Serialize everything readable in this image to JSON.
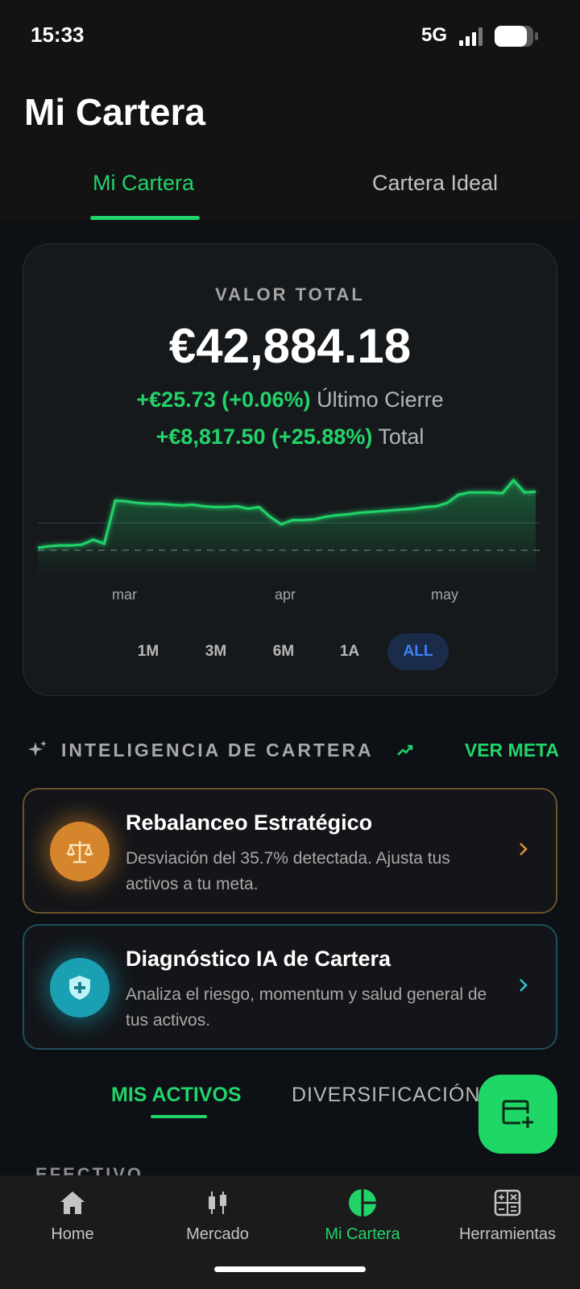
{
  "status_bar": {
    "time": "15:33",
    "network": "5G"
  },
  "header": {
    "title": "Mi Cartera"
  },
  "tabs": [
    {
      "label": "Mi Cartera",
      "active": true
    },
    {
      "label": "Cartera Ideal",
      "active": false
    }
  ],
  "portfolio": {
    "label": "VALOR TOTAL",
    "value": "€42,884.18",
    "last_close_change": "+€25.73 (+0.06%)",
    "last_close_label": "Último Cierre",
    "total_change": "+€8,817.50 (+25.88%)",
    "total_label": "Total"
  },
  "chart_data": {
    "type": "line",
    "x_labels": [
      "mar",
      "apr",
      "may"
    ],
    "series": [
      {
        "values": [
          33200,
          33400,
          33500,
          33500,
          33600,
          34200,
          33700,
          39000,
          38900,
          38700,
          38600,
          38600,
          38500,
          38400,
          38500,
          38300,
          38200,
          38200,
          38300,
          38000,
          38200,
          37000,
          36100,
          36600,
          36600,
          36700,
          37000,
          37200,
          37300,
          37500,
          37600,
          37700,
          37800,
          37900,
          38000,
          38200,
          38300,
          38700,
          39700,
          40000,
          40000,
          40000,
          39900,
          41500,
          40000,
          40100
        ]
      }
    ],
    "color": "#22d36a",
    "range_options": [
      "1M",
      "3M",
      "6M",
      "1A",
      "ALL"
    ],
    "selected_range": "ALL"
  },
  "intelligence": {
    "title": "INTELIGENCIA DE CARTERA",
    "action_label": "VER META",
    "cards": [
      {
        "title": "Rebalanceo Estratégico",
        "description": "Desviación del 35.7% detectada. Ajusta tus activos a tu meta.",
        "icon": "balance-scale-icon",
        "accent": "#d5852c"
      },
      {
        "title": "Diagnóstico IA de Cartera",
        "description": "Analiza el riesgo, momentum y salud general de tus activos.",
        "icon": "shield-plus-icon",
        "accent": "#1a9fb3"
      }
    ]
  },
  "sub_tabs": [
    {
      "label": "MIS ACTIVOS",
      "active": true
    },
    {
      "label": "DIVERSIFICACIÓN",
      "active": false
    }
  ],
  "section_peek": "EFECTIVO",
  "bottom_nav": [
    {
      "label": "Home",
      "icon": "home-icon",
      "active": false
    },
    {
      "label": "Mercado",
      "icon": "candlestick-icon",
      "active": false
    },
    {
      "label": "Mi Cartera",
      "icon": "pie-chart-icon",
      "active": true
    },
    {
      "label": "Herramientas",
      "icon": "calculator-icon",
      "active": false
    }
  ]
}
